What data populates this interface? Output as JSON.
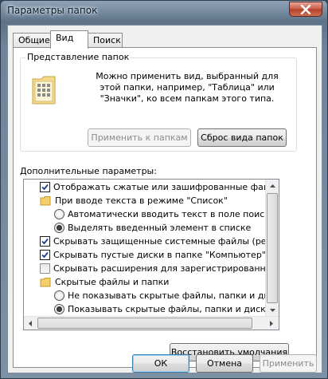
{
  "window": {
    "title": "Параметры папок",
    "close_icon": "close-icon"
  },
  "tabs": [
    {
      "label": "Общие",
      "active": false
    },
    {
      "label": "Вид",
      "active": true
    },
    {
      "label": "Поиск",
      "active": false
    }
  ],
  "folder_view": {
    "legend": "Представление папок",
    "description": "Можно применить вид, выбранный для этой папки, например, \"Таблица\" или \"Значки\", ко всем папкам этого типа.",
    "apply_button": "Применить к папкам",
    "reset_button": "Сброс вида папок"
  },
  "advanced": {
    "label": "Дополнительные параметры:",
    "items": [
      {
        "type": "checkbox",
        "checked": true,
        "indent": 0,
        "label": "Отображать сжатые или зашифрованные файлы NTFS"
      },
      {
        "type": "folder",
        "indent": 0,
        "label": "При вводе текста в режиме \"Список\""
      },
      {
        "type": "radio",
        "checked": false,
        "indent": 1,
        "label": "Автоматически вводить текст в поле поиска"
      },
      {
        "type": "radio",
        "checked": true,
        "indent": 1,
        "label": "Выделять введенный элемент в списке"
      },
      {
        "type": "checkbox",
        "checked": true,
        "indent": 0,
        "label": "Скрывать защищенные системные файлы (рекомендуется)"
      },
      {
        "type": "checkbox",
        "checked": true,
        "indent": 0,
        "label": "Скрывать пустые диски в папке \"Компьютер\""
      },
      {
        "type": "checkbox",
        "checked": false,
        "indent": 0,
        "label": "Скрывать расширения для зарегистрированных типов файлов"
      },
      {
        "type": "folder",
        "indent": 0,
        "label": "Скрытые файлы и папки"
      },
      {
        "type": "radio",
        "checked": false,
        "indent": 1,
        "label": "Не показывать скрытые файлы, папки и диски"
      },
      {
        "type": "radio",
        "checked": true,
        "indent": 1,
        "label": "Показывать скрытые файлы, папки и диски"
      }
    ]
  },
  "restore_button": "Восстановить умолчания",
  "footer": {
    "ok": "ОК",
    "cancel": "Отмена",
    "apply": "Применить"
  }
}
